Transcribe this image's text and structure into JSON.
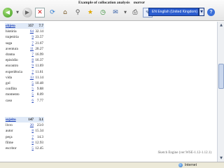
{
  "toolbar": {
    "page_title": "Example of collocation analysis",
    "page_title_kw": "marrar",
    "language": "EN English (United Kingdom)"
  },
  "groups": [
    {
      "header": {
        "word": "objeto",
        "count": "357",
        "score": "7.7"
      },
      "rows": [
        {
          "word": "história",
          "count": "64",
          "score": "32.14"
        },
        {
          "word": "trajetória",
          "count": "9",
          "score": "23.57"
        },
        {
          "word": "saga",
          "count": "7",
          "score": "21.67"
        },
        {
          "word": "aventura",
          "count": "11",
          "score": "20.27"
        },
        {
          "word": "drama",
          "count": "7",
          "score": "16.99"
        },
        {
          "word": "episódio",
          "count": "8",
          "score": "16.37"
        },
        {
          "word": "encontro",
          "count": "9",
          "score": "11.69"
        },
        {
          "word": "experiência",
          "count": "7",
          "score": "11.61"
        },
        {
          "word": "vida",
          "count": "13",
          "score": "11.14"
        },
        {
          "word": "gol",
          "count": "5",
          "score": "10.48"
        },
        {
          "word": "conflito",
          "count": "5",
          "score": "9.88"
        },
        {
          "word": "momento",
          "count": "5",
          "score": "8.09"
        },
        {
          "word": "caso",
          "count": "6",
          "score": "7.77"
        }
      ]
    },
    {
      "header": {
        "word": "sujeito",
        "count": "147",
        "score": "3.1"
      },
      "rows": [
        {
          "word": "livro",
          "count": "20",
          "score": "23.0"
        },
        {
          "word": "autor",
          "count": "8",
          "score": "15.34"
        },
        {
          "word": "peça",
          "count": "7",
          "score": "14.3"
        },
        {
          "word": "filme",
          "count": "8",
          "score": "12.93"
        },
        {
          "word": "escritor",
          "count": "5",
          "score": "12.45"
        }
      ]
    }
  ],
  "footer": "Sketch Engine (ver:WSE-1.12-1.12.1)",
  "status": {
    "zone_label": "Internet"
  }
}
